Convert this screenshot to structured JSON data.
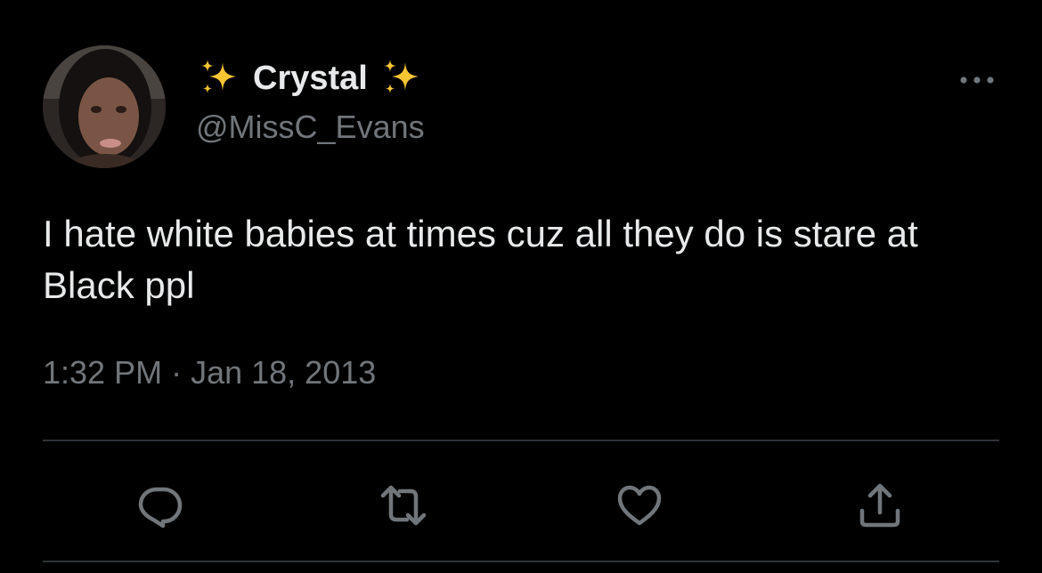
{
  "tweet": {
    "author": {
      "display_name": "Crystal",
      "name_emoji": "sparkles",
      "handle": "@MissC_Evans"
    },
    "text": "I hate white babies at times cuz all they do is stare at Black ppl",
    "time": "1:32 PM",
    "separator": "·",
    "date": "Jan 18, 2013"
  },
  "actions": {
    "reply_icon": "reply-icon",
    "retweet_icon": "retweet-icon",
    "like_icon": "like-icon",
    "share_icon": "share-icon",
    "more_icon": "more-icon"
  },
  "colors": {
    "background": "#000000",
    "primary_text": "#e7e9ea",
    "secondary_text": "#71767b",
    "divider": "#2f3336",
    "sparkle": "#f5c533"
  }
}
